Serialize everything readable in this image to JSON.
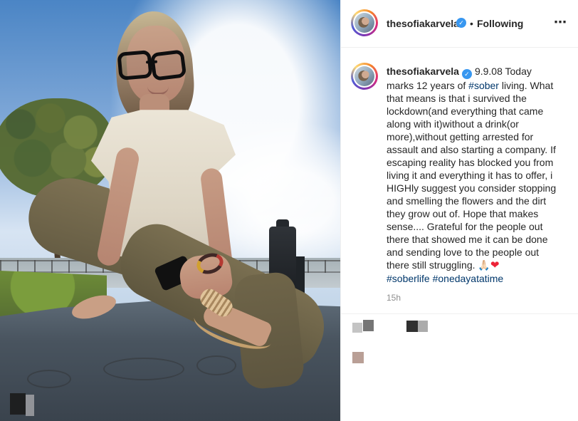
{
  "post": {
    "username": "thesofiakarvela",
    "following_label": "Following",
    "dot": "•",
    "more_label": "⋯",
    "verified_mark": "✓",
    "caption": {
      "intro": "9.9.08 Today marks 12 years of ",
      "hashtag_sober": "#sober",
      "body": " living. What that means is that i survived the lockdown(and everything that came along with it)without a drink(or more),without getting arrested for assault and also starting a company. If escaping reality has blocked you from living it and everything it has to offer, i HIGHly suggest you consider stopping and smelling the flowers and the dirt they grow out of. Hope that makes sense.... Grateful for the people out there that showed me it can be done and sending love to the people out there still struggling. ",
      "emoji_hands": "🙏🏻",
      "emoji_heart": "❤",
      "hashtag_1": "#soberlife",
      "hashtag_2": "#onedayatatime"
    },
    "timestamp": "15h"
  },
  "colors": {
    "verified": "#3897f0",
    "hashtag": "#00376b",
    "text": "#262626",
    "muted": "#8e8e8e",
    "heart": "#ed2338",
    "gradient_ring": [
      "#f58529",
      "#dd2a7b",
      "#8134af",
      "#515bd4",
      "#feda77"
    ]
  },
  "icons": {
    "verified": "verified-badge-icon",
    "more": "more-options-icon",
    "heart": "heart-emoji-icon",
    "hands": "praying-hands-emoji-icon"
  }
}
